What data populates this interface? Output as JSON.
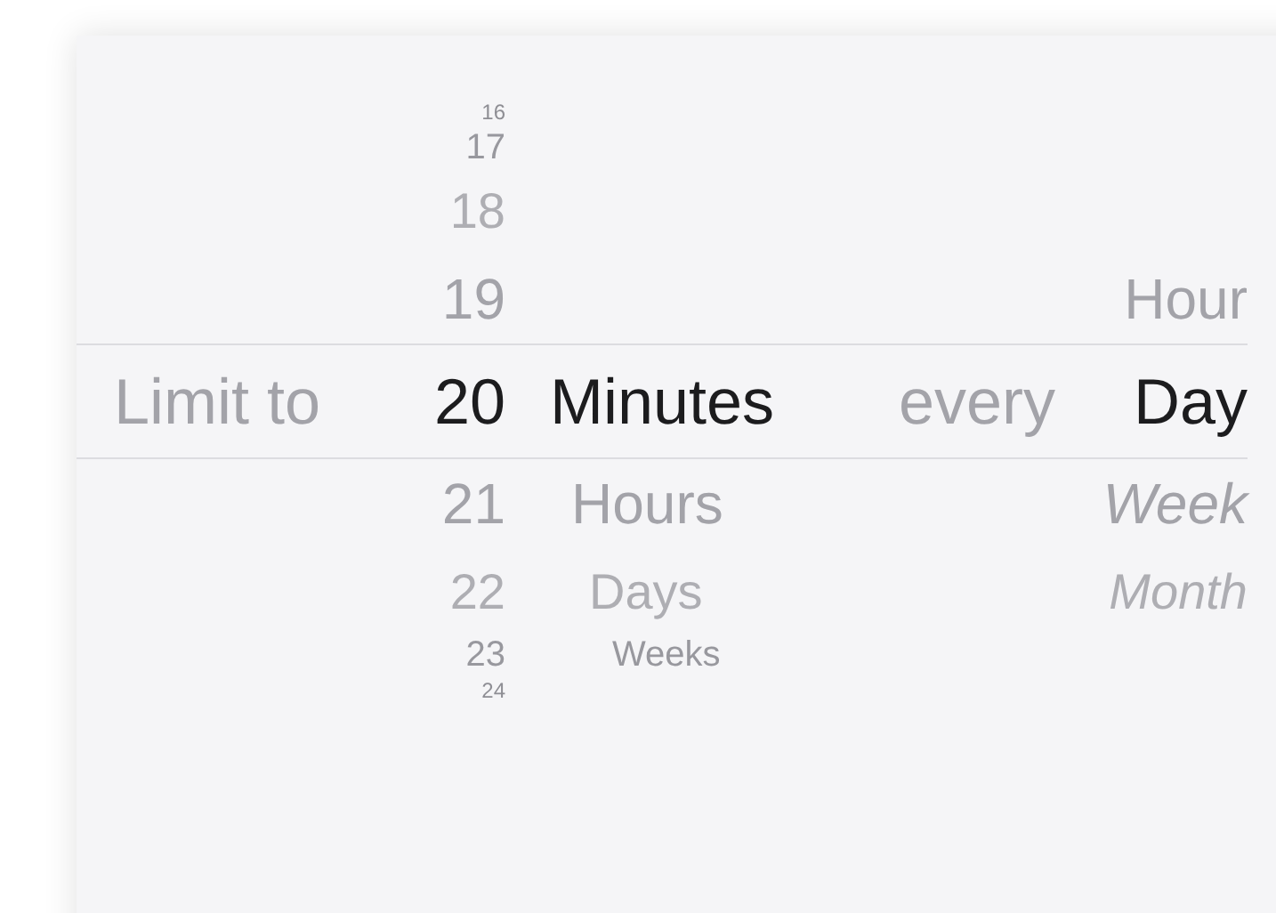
{
  "columns": [
    {
      "kind": "label",
      "text": "Limit to"
    },
    {
      "kind": "number-wheel",
      "items": [
        {
          "text": "16",
          "selected": false
        },
        {
          "text": "17",
          "selected": false
        },
        {
          "text": "18",
          "selected": false
        },
        {
          "text": "19",
          "selected": false
        },
        {
          "text": "20",
          "selected": true
        },
        {
          "text": "21",
          "selected": false
        },
        {
          "text": "22",
          "selected": false
        },
        {
          "text": "23",
          "selected": false
        },
        {
          "text": "24",
          "selected": false
        }
      ]
    },
    {
      "kind": "unit-wheel",
      "items": [
        {
          "text": "Minutes",
          "selected": true
        },
        {
          "text": "Hours",
          "selected": false
        },
        {
          "text": "Days",
          "selected": false
        },
        {
          "text": "Weeks",
          "selected": false
        }
      ]
    },
    {
      "kind": "label",
      "text": "every"
    },
    {
      "kind": "period-wheel",
      "items": [
        {
          "text": "Hour",
          "selected": false
        },
        {
          "text": "Day",
          "selected": true
        },
        {
          "text": "Week",
          "selected": false
        },
        {
          "text": "Month",
          "selected": false
        }
      ]
    }
  ]
}
